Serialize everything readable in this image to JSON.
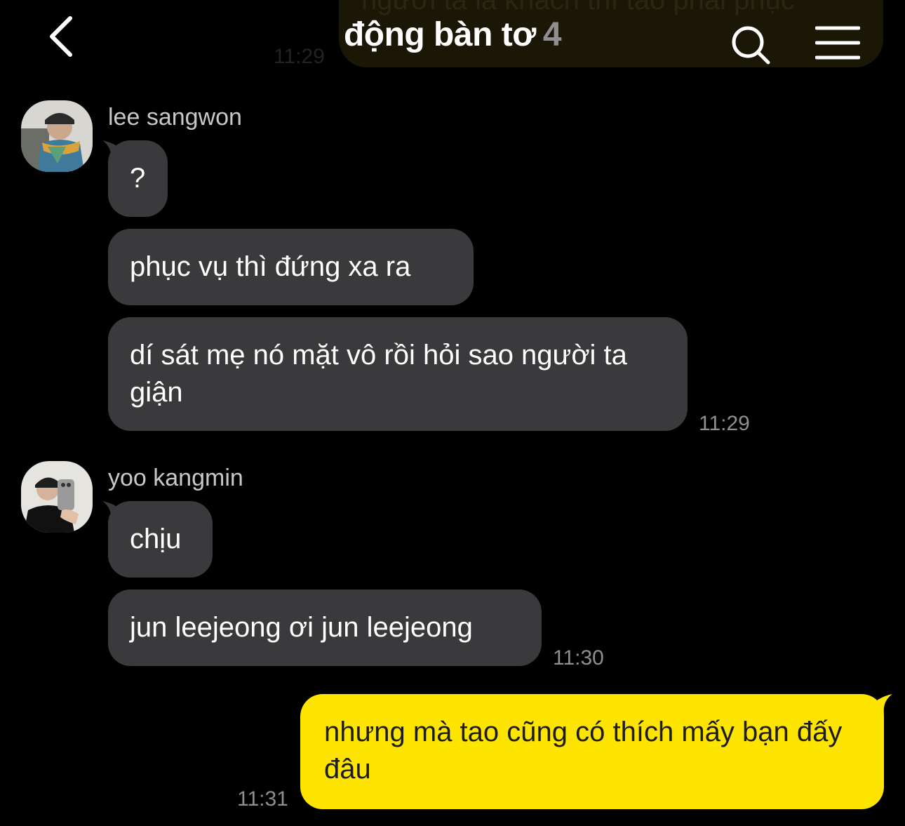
{
  "header": {
    "title": "động bàn tơ",
    "member_count": "4"
  },
  "background_message": {
    "text": "người ta là khách thì tao phải phục",
    "time": "11:29"
  },
  "messages": [
    {
      "sender": "lee sangwon",
      "bubbles": [
        "?",
        "phục vụ thì đứng xa ra",
        "dí sát mẹ nó mặt vô rồi hỏi sao người ta giận"
      ],
      "time": "11:29"
    },
    {
      "sender": "yoo kangmin",
      "bubbles": [
        "chịu",
        "jun leejeong ơi jun leejeong"
      ],
      "time": "11:30"
    },
    {
      "sender": "me",
      "bubbles": [
        "nhưng mà tao cũng có thích mấy bạn đấy đâu"
      ],
      "time": "11:31"
    }
  ],
  "colors": {
    "background": "#000000",
    "incoming_bubble": "#3a3a3c",
    "outgoing_bubble": "#fee500",
    "timestamp": "#8e8e93"
  }
}
